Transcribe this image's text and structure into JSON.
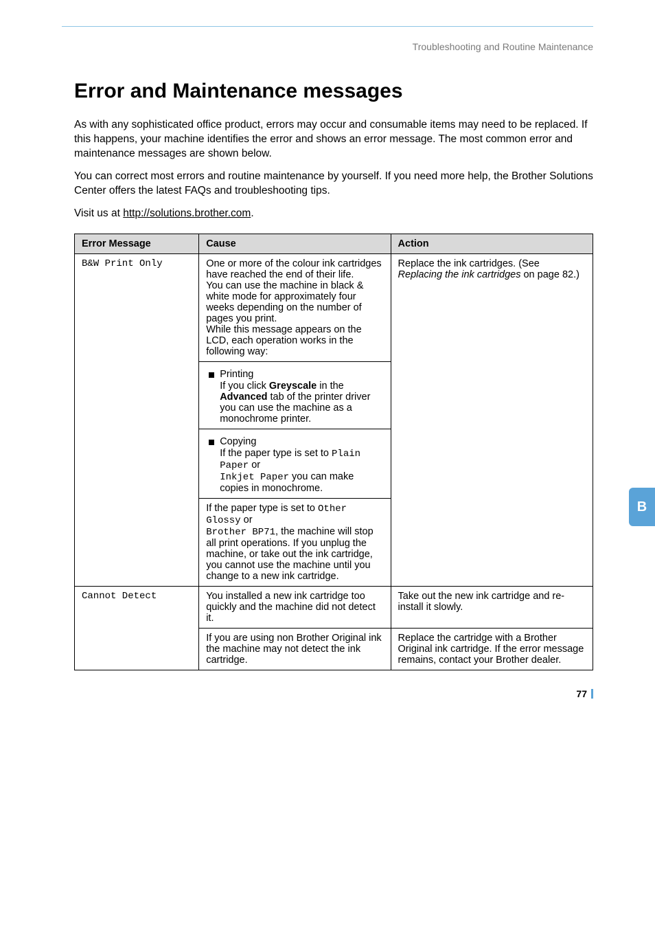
{
  "header": {
    "section": "Troubleshooting and Routine Maintenance"
  },
  "title": "Error and Maintenance messages",
  "paragraphs": {
    "p1": "As with any sophisticated office product, errors may occur and consumable items may need to be replaced. If this happens, your machine identifies the error and shows an error message. The most common error and maintenance messages are shown below.",
    "p2a": "You can correct most errors and routine maintenance by yourself. If you need more help, the Brother Solutions Center offers the latest FAQs and troubleshooting tips.",
    "p3a": "Visit us at ",
    "p3_link": "http://solutions.brother.com",
    "p3b": "."
  },
  "table": {
    "headers": {
      "c1": "Error Message",
      "c2": "Cause",
      "c3": "Action"
    },
    "row1": {
      "msg": "B&W Print Only",
      "cause1": "One or more of the colour ink cartridges have reached the end of their life.\nYou can use the machine in black & white mode for approximately four weeks depending on the number of pages you print.\nWhile this message appears on the LCD, each operation works in the following way:",
      "action1a": "Replace the ink cartridges. (See ",
      "action1b": "Replacing the ink cartridges",
      "action1c": " on page 82.)",
      "b1_title": "Printing",
      "b1_a": "If you click ",
      "b1_bold1": "Greyscale",
      "b1_b": " in the ",
      "b1_bold2": "Advanced",
      "b1_c": " tab of the printer driver you can use the machine as a monochrome printer.",
      "b2_title": "Copying",
      "b2_a": "If the paper type is set to ",
      "b2_mono1": "Plain Paper",
      "b2_b": " or ",
      "b2_mono2": "Inkjet Paper",
      "b2_c": " you can make copies in monochrome.",
      "c4a": "If the paper type is set to ",
      "c4_mono1": "Other Glossy",
      "c4b": " or ",
      "c4_mono2": "Brother BP71",
      "c4c": ", the machine will stop all print operations. If you unplug the machine, or take out the ink cartridge, you cannot use the machine until you change to a new ink cartridge."
    },
    "row2": {
      "msg": "Cannot Detect",
      "cause1": "You installed a new ink cartridge too quickly and the machine did not detect it.",
      "action1": "Take out the new ink cartridge and re-install it slowly.",
      "cause2": "If you are using non Brother Original ink the machine may not detect the ink cartridge.",
      "action2": "Replace the cartridge with a Brother Original ink cartridge. If the error message remains, contact your Brother dealer."
    }
  },
  "side_tab": "B",
  "page_number": "77"
}
